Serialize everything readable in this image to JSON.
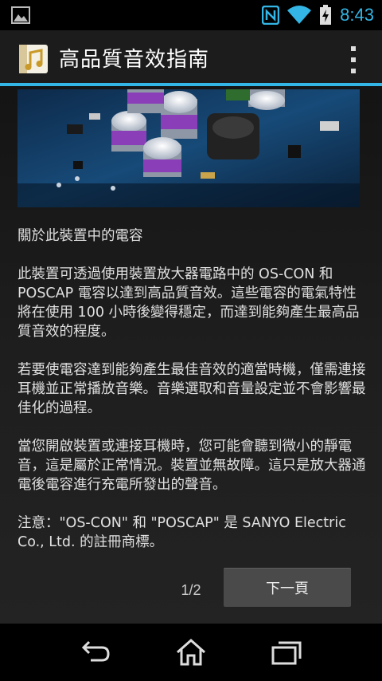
{
  "status_bar": {
    "time": "8:43",
    "icons": [
      "gallery-notification-icon",
      "nfc-icon",
      "wifi-icon",
      "battery-charging-icon"
    ]
  },
  "action_bar": {
    "title": "高品質音效指南",
    "app_icon": "music-note-app-icon",
    "overflow_icon": "overflow-menu-icon"
  },
  "content": {
    "heading": "關於此裝置中的電容",
    "paragraphs": [
      "此裝置可透過使用裝置放大器電路中的 OS-CON 和 POSCAP 電容以達到高品質音效。這些電容的電氣特性將在使用 100 小時後變得穩定，而達到能夠產生最高品質音效的程度。",
      "若要使電容達到能夠產生最佳音效的適當時機，僅需連接耳機並正常播放音樂。音樂選取和音量設定並不會影響最佳化的過程。",
      "當您開啟裝置或連接耳機時，您可能會聽到微小的靜電音，這是屬於正常情況。裝置並無故障。這只是放大器通電後電容進行充電所發出的聲音。",
      "注意：\"OS-CON\" 和 \"POSCAP\" 是 SANYO Electric Co., Ltd. 的註冊商標。"
    ],
    "pager": "1/2",
    "next_button": "下一頁"
  },
  "nav_bar": {
    "icons": [
      "back-icon",
      "home-icon",
      "recent-apps-icon"
    ]
  },
  "colors": {
    "accent": "#33b5e5",
    "actionbar_bg": "#1c1c1c",
    "button_bg": "#4a4a4a"
  }
}
